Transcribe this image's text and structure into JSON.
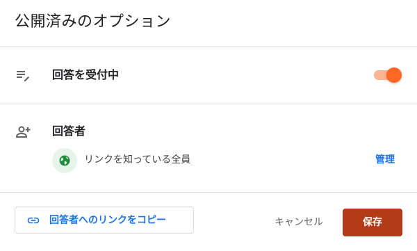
{
  "dialog": {
    "title": "公開済みのオプション"
  },
  "accepting_responses": {
    "label": "回答を受付中",
    "icon": "list-edit-icon",
    "toggle_on": true,
    "toggle_color": "#ff6723"
  },
  "responders": {
    "label": "回答者",
    "icon": "person-add-icon",
    "access_icon": "globe-icon",
    "access_text": "リンクを知っている全員",
    "manage_label": "管理"
  },
  "footer": {
    "copy_link_label": "回答者へのリンクをコピー",
    "copy_link_icon": "link-icon",
    "cancel_label": "キャンセル",
    "save_label": "保存",
    "save_color": "#b33b17",
    "link_color": "#1a73e8"
  }
}
